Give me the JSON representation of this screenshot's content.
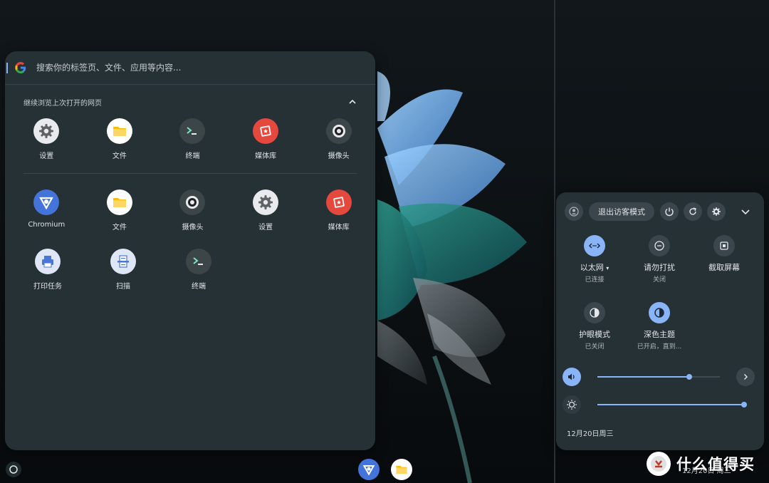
{
  "search": {
    "placeholder": "搜索你的标签页、文件、应用等内容..."
  },
  "continue_section": {
    "title": "继续浏览上次打开的网页"
  },
  "recent_apps": [
    {
      "label": "设置",
      "icon": "gear-icon"
    },
    {
      "label": "文件",
      "icon": "folder-icon"
    },
    {
      "label": "终端",
      "icon": "terminal-icon"
    },
    {
      "label": "媒体库",
      "icon": "gallery-icon"
    },
    {
      "label": "摄像头",
      "icon": "camera-icon"
    }
  ],
  "all_apps_row1": [
    {
      "label": "Chromium",
      "icon": "chromium-icon"
    },
    {
      "label": "文件",
      "icon": "folder-icon"
    },
    {
      "label": "摄像头",
      "icon": "camera-icon"
    },
    {
      "label": "设置",
      "icon": "gear-icon"
    },
    {
      "label": "媒体库",
      "icon": "gallery-icon"
    }
  ],
  "all_apps_row2": [
    {
      "label": "打印任务",
      "icon": "printer-icon"
    },
    {
      "label": "扫描",
      "icon": "scanner-icon"
    },
    {
      "label": "终端",
      "icon": "terminal-icon"
    }
  ],
  "quick_settings": {
    "exit_guest_label": "退出访客模式",
    "tiles": [
      {
        "label": "以太网",
        "sub": "已连接",
        "icon": "ethernet-icon",
        "on": true,
        "has_dropdown": true
      },
      {
        "label": "请勿打扰",
        "sub": "关闭",
        "icon": "do-not-disturb-icon",
        "on": false
      },
      {
        "label": "截取屏幕",
        "sub": "",
        "icon": "screen-capture-icon",
        "on": false
      },
      {
        "label": "护眼模式",
        "sub": "已关闭",
        "icon": "night-light-icon",
        "on": false
      },
      {
        "label": "深色主题",
        "sub": "已开启，直到...",
        "icon": "dark-theme-icon",
        "on": true
      }
    ],
    "volume_level": 0.75,
    "brightness_level": 1.0,
    "date": "12月20日周三"
  },
  "shelf": {
    "tray_date": "12月20日 周三"
  },
  "watermark": {
    "text": "什么值得买"
  },
  "colors": {
    "accent": "#8ab4f8",
    "panel": "#263136",
    "gallery_red": "#e5483d",
    "folder_yellow": "#fbbc04",
    "chromium_blue": "#4473d9"
  }
}
